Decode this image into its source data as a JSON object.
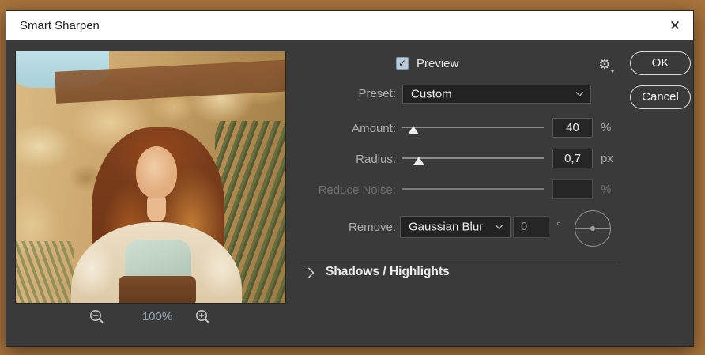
{
  "dialog": {
    "title": "Smart Sharpen"
  },
  "header": {
    "preview_label": "Preview",
    "preview_checked": true,
    "check_glyph": "✓",
    "gear_glyph": "⚙"
  },
  "buttons": {
    "ok": "OK",
    "cancel": "Cancel"
  },
  "preset": {
    "label": "Preset:",
    "value": "Custom"
  },
  "sliders": [
    {
      "label": "Amount:",
      "value": "40",
      "unit": "%",
      "thumb_left": "8%",
      "disabled": false
    },
    {
      "label": "Radius:",
      "value": "0,7",
      "unit": "px",
      "thumb_left": "12%",
      "disabled": false
    },
    {
      "label": "Reduce Noise:",
      "value": "",
      "unit": "%",
      "disabled": true
    }
  ],
  "remove": {
    "label": "Remove:",
    "value": "Gaussian Blur",
    "angle_value": "0",
    "angle_unit": "°"
  },
  "shadows_highlights": {
    "label": "Shadows / Highlights"
  },
  "zoom_controls": {
    "level": "100%"
  },
  "colors": {
    "dialog_bg": "#3a3a3a",
    "titlebar_bg": "#ffffff",
    "label_gray": "#adadad",
    "disabled_gray": "#6d6d6d",
    "checkbox_blue": "#bccbd8",
    "zoom_level_blue": "#93a4b2",
    "field_bg": "#262626"
  }
}
